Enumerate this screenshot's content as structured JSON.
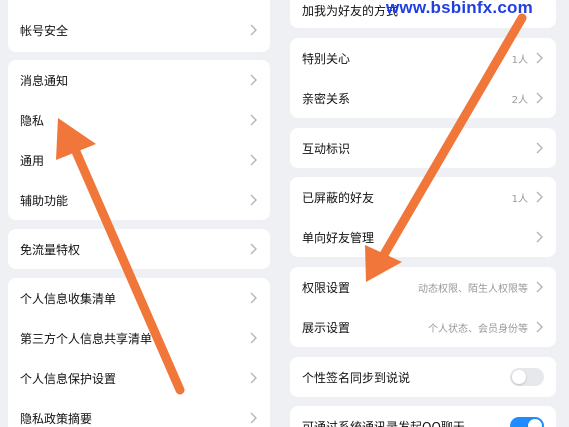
{
  "watermark": "www.bsbinfx.com",
  "colors": {
    "arrow": "#f0763a",
    "toggle_on": "#1e8cff",
    "watermark": "#1f3fe0"
  },
  "left": {
    "account_security": "帐号安全",
    "notifications": "消息通知",
    "privacy": "隐私",
    "general": "通用",
    "accessibility": "辅助功能",
    "data_saver": "免流量特权",
    "personal_info_list": "个人信息收集清单",
    "third_party_share_list": "第三方个人信息共享清单",
    "personal_info_protection": "个人信息保护设置",
    "privacy_policy_summary": "隐私政策摘要"
  },
  "right": {
    "add_friend_method": "加我为好友的方式",
    "special_care": {
      "label": "特别关心",
      "value": "1人"
    },
    "close_relations": {
      "label": "亲密关系",
      "value": "2人"
    },
    "interaction_marks": "互动标识",
    "blocked_friends": {
      "label": "已屏蔽的好友",
      "value": "1人"
    },
    "one_way_friends": "单向好友管理",
    "permission_settings": {
      "label": "权限设置",
      "value": "动态权限、陌生人权限等"
    },
    "display_settings": {
      "label": "展示设置",
      "value": "个人状态、会员身份等"
    },
    "signature_sync": {
      "label": "个性签名同步到说说",
      "toggle": "off"
    },
    "contacts_call": {
      "label": "可通过系统通讯录发起QQ聊天",
      "toggle": "on"
    }
  }
}
